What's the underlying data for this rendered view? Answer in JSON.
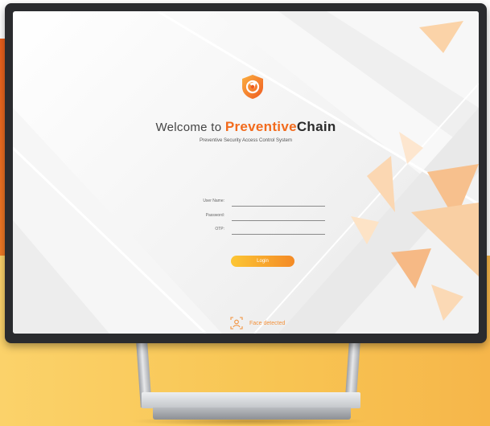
{
  "login": {
    "welcome_prefix": "Welcome to ",
    "brand_part1": "Preventive",
    "brand_part2": "Chain",
    "subtitle": "Preventive Security Access Control System",
    "fields": {
      "username_label": "User Name:",
      "username_value": "",
      "password_label": "Password:",
      "password_value": "",
      "otp_label": "OTP:",
      "otp_value": ""
    },
    "login_button": "Login",
    "face_status": "Face detected"
  },
  "icons": {
    "logo": "shield-logo-icon",
    "face": "face-scan-icon"
  },
  "colors": {
    "brand_orange": "#f26b1d",
    "brand_dark": "#2b2b2b",
    "button_start": "#fcc634",
    "button_end": "#f48a26",
    "face_status": "#f3923c",
    "page_orange": "#e95f1c",
    "page_yellow": "#f8c553"
  }
}
